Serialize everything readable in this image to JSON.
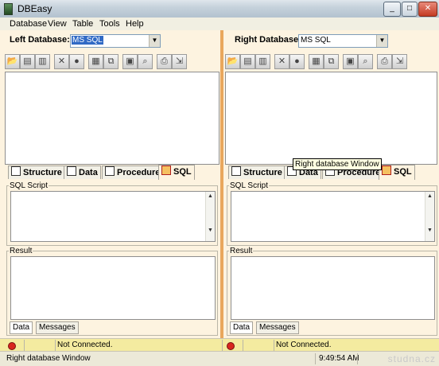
{
  "window": {
    "title": "DBEasy",
    "min_glyph": "_",
    "max_glyph": "□",
    "close_glyph": "✕"
  },
  "menu": [
    "Database",
    "View",
    "Table",
    "Tools",
    "Help"
  ],
  "left": {
    "label": "Left Database:",
    "value": "MS SQL"
  },
  "right": {
    "label": "Right Database:",
    "value": "MS SQL"
  },
  "tabs": [
    "Structure",
    "Data",
    "Procedure",
    "SQL"
  ],
  "sql_script_label": "SQL Script",
  "result_label": "Result",
  "bottom_tabs": [
    "Data",
    "Messages"
  ],
  "status": {
    "left_state": "Not Connected.",
    "right_state": "Not Connected.",
    "message": "Right database Window",
    "time": "9:49:54 AM"
  },
  "tooltip": "Right database Window",
  "watermark": "studna.cz",
  "toolbar_icons": [
    "open-icon",
    "connect-icon",
    "disconnect-icon",
    "delete-icon",
    "stop-icon",
    "table-icon",
    "copy-icon",
    "preview-icon",
    "find-icon",
    "print-icon",
    "export-icon"
  ],
  "toolbar_glyphs": [
    "📂",
    "▤",
    "▥",
    "✕",
    "●",
    "▦",
    "⧉",
    "▣",
    "⌕",
    "⎙",
    "⇲"
  ],
  "tab_icons": [
    "structure-icon",
    "data-grid-icon",
    "procedure-icon",
    "sql-icon"
  ]
}
